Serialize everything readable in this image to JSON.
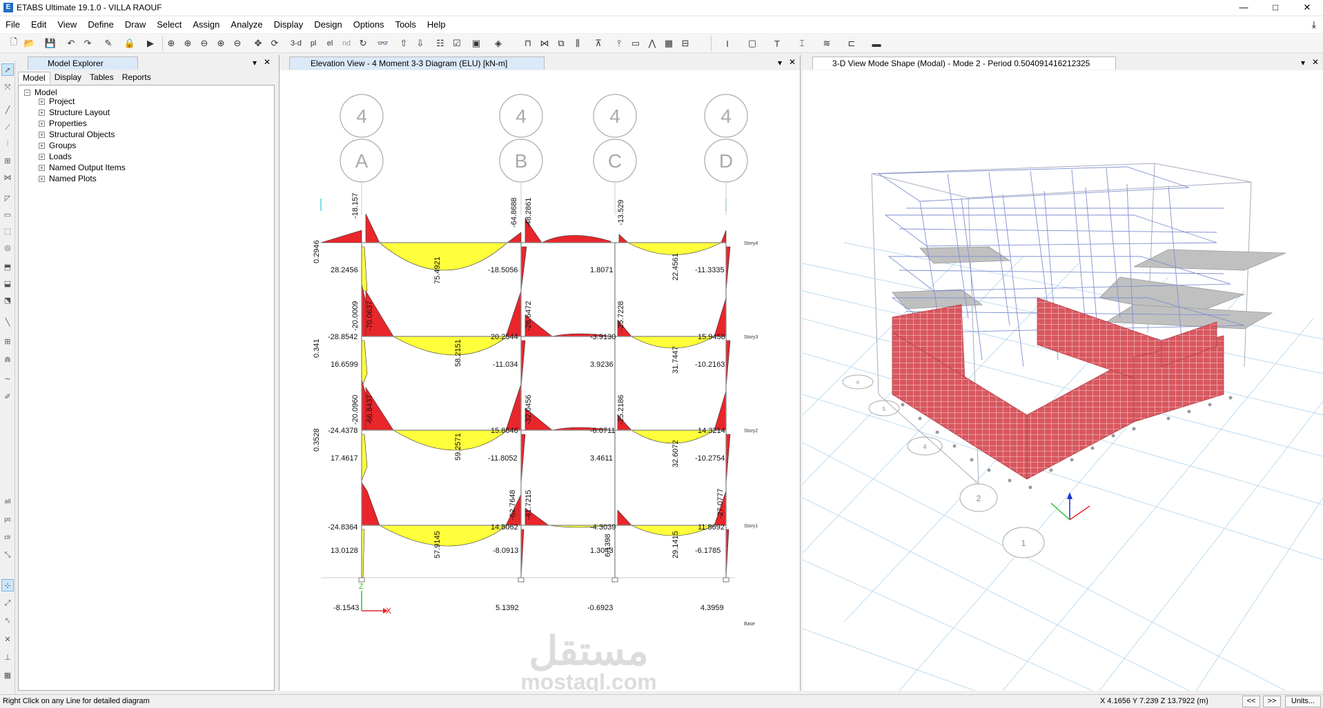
{
  "window": {
    "title": "ETABS Ultimate 19.1.0 - VILLA RAOUF",
    "minimize": "—",
    "maximize": "□",
    "close": "✕"
  },
  "menu": [
    "File",
    "Edit",
    "View",
    "Define",
    "Draw",
    "Select",
    "Assign",
    "Analyze",
    "Display",
    "Design",
    "Options",
    "Tools",
    "Help"
  ],
  "toolbar": {
    "view_3d": "3-d",
    "plan": "pl",
    "elev": "el",
    "nd": "nd"
  },
  "explorer": {
    "title": "Model Explorer",
    "subtabs": [
      "Model",
      "Display",
      "Tables",
      "Reports"
    ],
    "root": "Model",
    "items": [
      "Project",
      "Structure Layout",
      "Properties",
      "Structural Objects",
      "Groups",
      "Loads",
      "Named Output Items",
      "Named Plots"
    ]
  },
  "elevation": {
    "title": "Elevation View - 4   Moment 3-3 Diagram   (ELU)  [kN-m]",
    "grid_top": [
      "4",
      "4",
      "4",
      "4"
    ],
    "grid_bottom": [
      "A",
      "B",
      "C",
      "D"
    ],
    "stories": [
      "Story4",
      "Story3",
      "Story2",
      "Story1",
      "Base"
    ],
    "labels": {
      "s4": [
        "0.2946",
        "28.2456",
        "-18.157",
        "75.4921",
        "-18.5056",
        "-64.8688",
        "-48.2861",
        "1.8071",
        "-13.529",
        "22.4561",
        "-11.3335"
      ],
      "s3": [
        "0.341",
        "-28.8542",
        "16.6599",
        "-20.0009",
        "-70.0637",
        "58.2151",
        "20.2544",
        "-11.034",
        "-26.6472",
        "-3.9130",
        "3.9236",
        "-25.7228",
        "31.7447",
        "15.9458",
        "-10.2163"
      ],
      "s2": [
        "0.3528",
        "-24.4378",
        "17.4617",
        "-20.0960",
        "-66.8437",
        "59.2571",
        "15.8646",
        "-11.8052",
        "-32.0456",
        "-6.0711",
        "3.4611",
        "-25.2186",
        "32.6072",
        "14.3214",
        "-10.2754"
      ],
      "s1": [
        "-24.8364",
        "13.0128",
        "57.9145",
        "14.8062",
        "-8.0913",
        "-62.7648",
        "-41.7215",
        "-4.3039",
        "6.1398",
        "1.3043",
        "29.1415",
        "11.8692",
        "-27.0777",
        "-6.1785"
      ],
      "base": [
        "-8.1543",
        "5.1392",
        "-0.6923",
        "4.3959"
      ]
    },
    "axis_x": "X",
    "axis_z": "Z"
  },
  "view3d": {
    "title": "3-D View  Mode Shape (Modal) - Mode 2 - Period 0.504091416212325",
    "grid_bubbles": [
      "1",
      "2",
      "4",
      "5",
      "6"
    ]
  },
  "watermark": {
    "arabic": "مستقل",
    "latin": "mostaql.com"
  },
  "status": {
    "message": "Right Click on any Line for detailed diagram",
    "coords": "X 4.1656  Y 7.239  Z 13.7922 (m)",
    "prev": "<<",
    "next": ">>",
    "units": "Units..."
  },
  "colors": {
    "negative_moment": "#e8262b",
    "positive_moment": "#ffff3b",
    "wall": "#d9575f",
    "accent": "#1e6fc2"
  }
}
